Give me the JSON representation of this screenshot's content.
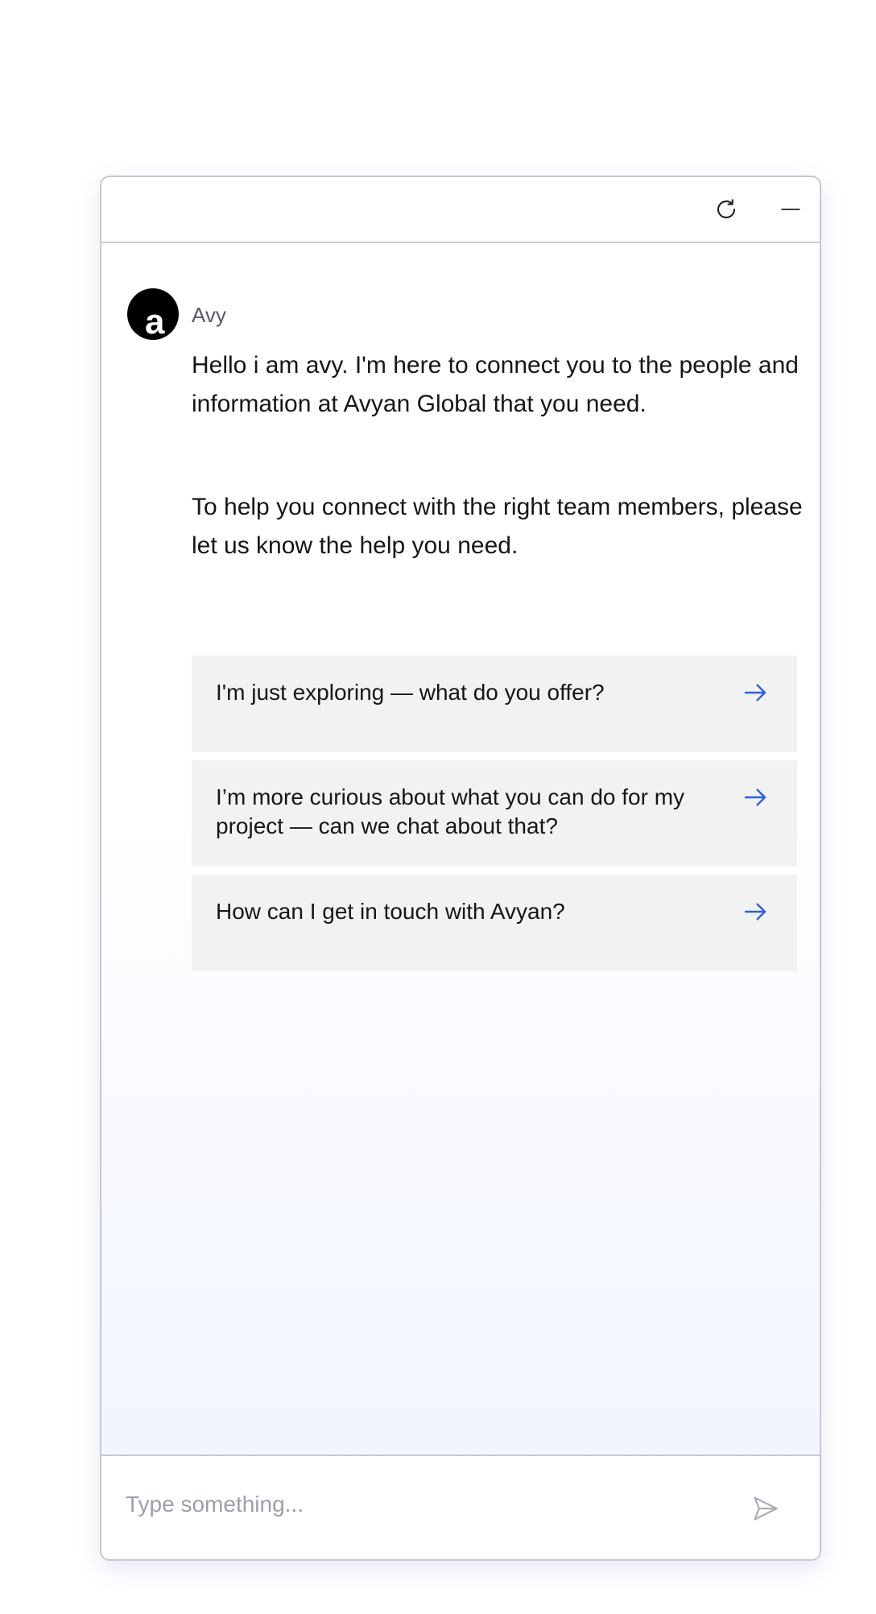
{
  "header": {
    "refresh_icon": "refresh-icon",
    "minimize_icon": "minimize-icon"
  },
  "conversation": {
    "avatar_letter": "a",
    "sender_name": "Avy",
    "messages": [
      "Hello i am avy. I'm here to connect you to the people and information at Avyan Global that you need.",
      "To help you connect with the right team members, please let us know the help you need."
    ],
    "options": [
      {
        "label": "I'm just exploring — what do you offer?",
        "icon": "arrow-right-icon"
      },
      {
        "label": "I’m more curious about what you can do for my project — can we chat about that?",
        "icon": "arrow-right-icon"
      },
      {
        "label": "How can I get in touch with Avyan?",
        "icon": "arrow-right-icon"
      }
    ]
  },
  "composer": {
    "placeholder": "Type something...",
    "value": "",
    "send_icon": "send-icon"
  },
  "colors": {
    "accent": "#2f5fd8",
    "option_bg": "#f2f2f2",
    "border": "#c6c9d1",
    "gradient_end": "#eff3ff"
  }
}
